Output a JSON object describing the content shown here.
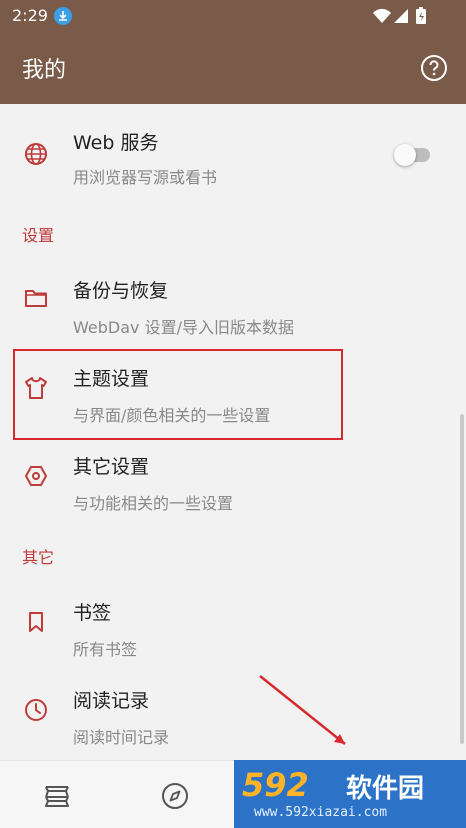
{
  "status_bar": {
    "time": "2:29"
  },
  "app_bar": {
    "title": "我的"
  },
  "items": {
    "web": {
      "title": "Web 服务",
      "subtitle": "用浏览器写源或看书"
    },
    "backup": {
      "title": "备份与恢复",
      "subtitle": "WebDav 设置/导入旧版本数据"
    },
    "theme": {
      "title": "主题设置",
      "subtitle": "与界面/颜色相关的一些设置"
    },
    "other_settings": {
      "title": "其它设置",
      "subtitle": "与功能相关的一些设置"
    },
    "bookmark": {
      "title": "书签",
      "subtitle": "所有书签"
    },
    "history": {
      "title": "阅读记录",
      "subtitle": "阅读时间记录"
    }
  },
  "sections": {
    "settings": "设置",
    "other": "其它"
  },
  "watermark": {
    "logo": "592",
    "site": "软件园",
    "url": "www.592xiazai.com"
  },
  "colors": {
    "app_bar": "#7a5a48",
    "accent": "#c03a3a",
    "highlight": "#d8292f"
  },
  "icons": {
    "web": "globe-icon",
    "backup": "folder-icon",
    "theme": "tshirt-icon",
    "other_settings": "hexagon-settings-icon",
    "bookmark": "bookmark-icon",
    "history": "clock-icon",
    "help": "help-circle-icon"
  }
}
